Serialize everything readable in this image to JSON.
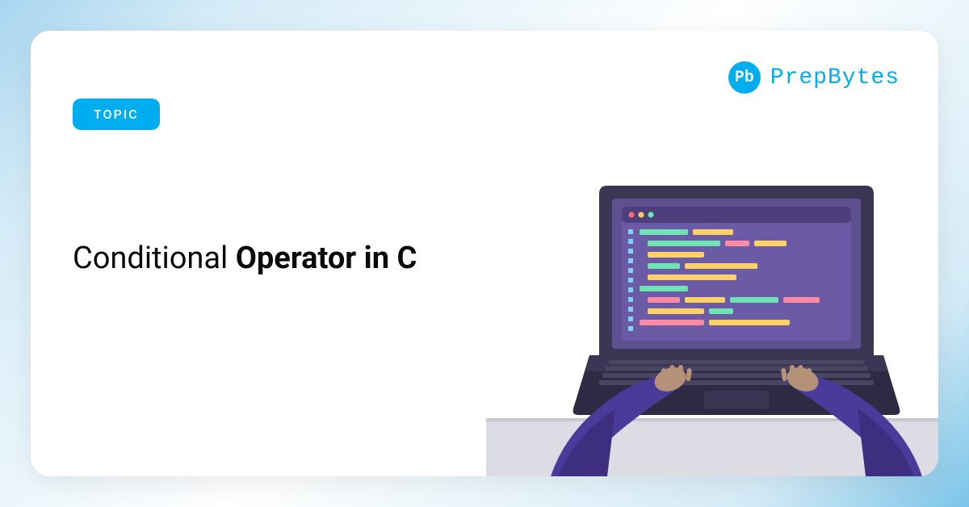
{
  "badge": {
    "label": "TOPIC"
  },
  "title": {
    "light": "Conditional ",
    "bold": "Operator in C"
  },
  "brand": {
    "name": "PrepBytes",
    "logo_text": "Pb"
  },
  "colors": {
    "accent": "#00aef0",
    "laptop": "#3a3654",
    "screen_bg": "#5f5091",
    "code_window": "#5f5091",
    "sleeve": "#4a3a99",
    "skin": "#b5917a",
    "desk": "#dcdde4"
  }
}
